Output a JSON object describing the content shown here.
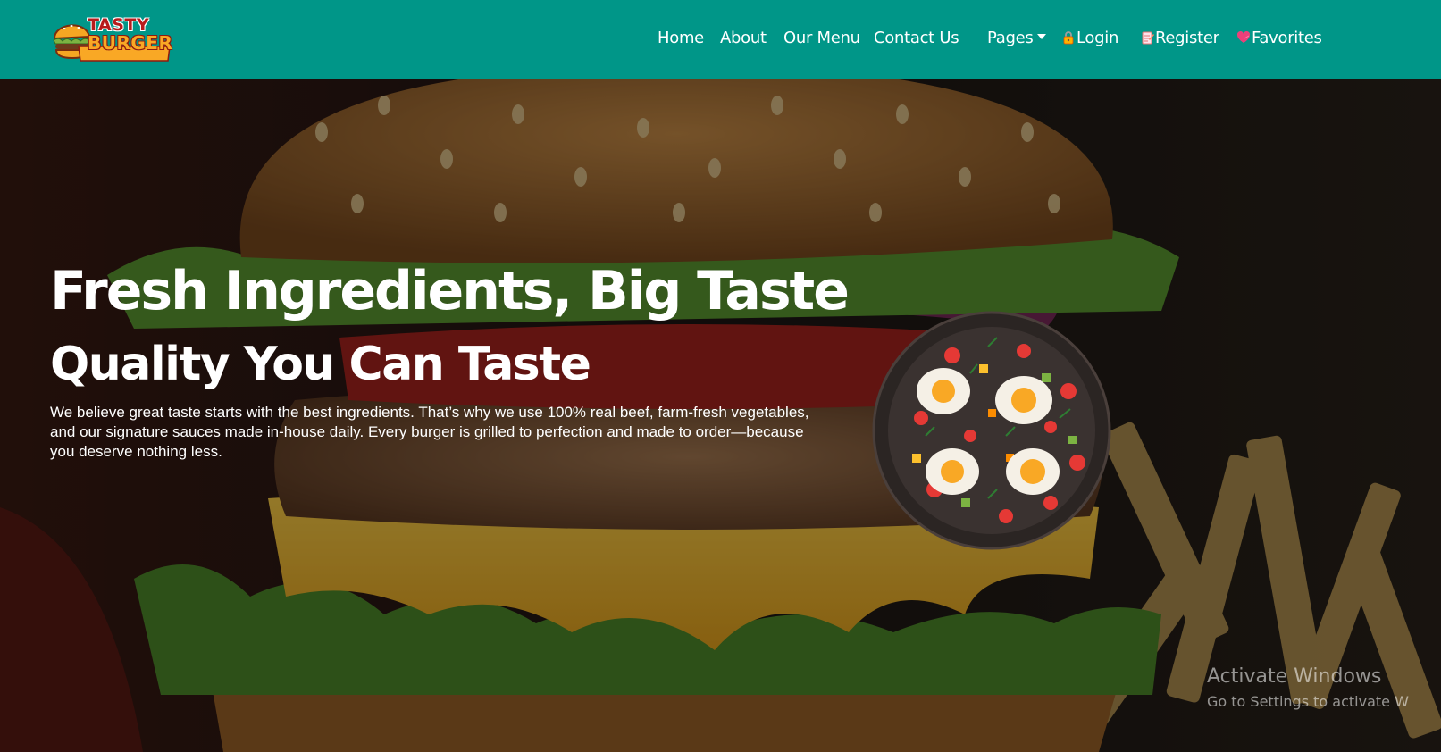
{
  "brand": {
    "logo_line1": "Tasty",
    "logo_line2": "Burger",
    "logo_icon": "burger-icon"
  },
  "nav": {
    "home": "Home",
    "about": "About",
    "menu": "Our Menu",
    "contact": "Contact Us",
    "pages": "Pages",
    "login": "Login",
    "register": "Register",
    "favorites": "Favorites",
    "login_icon": "lock-icon",
    "register_icon": "notepad-icon",
    "favorites_icon": "heart-icon"
  },
  "hero": {
    "title": "Fresh Ingredients, Big Taste",
    "subtitle": "Quality You Can Taste",
    "text": "We believe great taste starts with the best ingredients. That’s why we use 100% real beef, farm-fresh vegetables, and our signature sauces made in-house daily. Every burger is grilled to perfection and made to order—because you deserve nothing less.",
    "side_image": "egg-skillet-dish"
  },
  "watermark": {
    "line1": "Activate Windows",
    "line2": "Go to Settings to activate W"
  },
  "colors": {
    "navbar": "#009688",
    "text": "#ffffff",
    "logo_red": "#b71c1c",
    "logo_yellow": "#f9a825"
  }
}
